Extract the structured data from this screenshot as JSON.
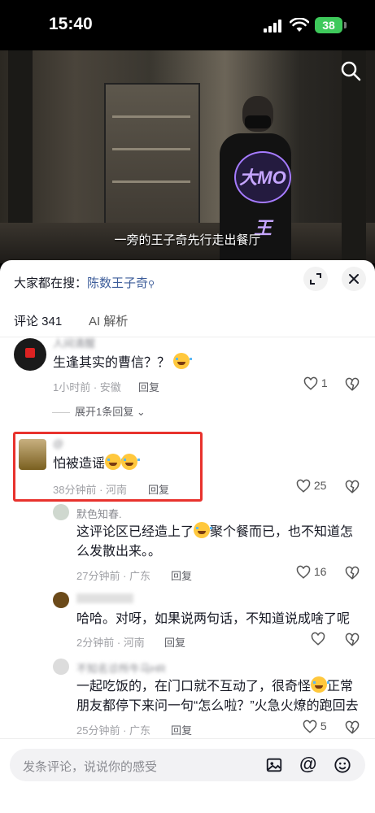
{
  "status_bar": {
    "time": "15:40",
    "battery": "38"
  },
  "video": {
    "subtitle": "一旁的王子奇先行走出餐厅",
    "watermark": "大MO王"
  },
  "panel": {
    "hot_search_label": "大家都在搜：",
    "hot_search_keyword": "陈数王子奇",
    "tabs": [
      {
        "label": "评论 341"
      },
      {
        "label": "AI 解析"
      }
    ]
  },
  "comments": [
    {
      "name": "人间清醒",
      "text": "生逢其实的曹信？？",
      "meta": "1小时前 · 安徽",
      "reply": "回复",
      "likes": "1",
      "expand": "展开1条回复"
    },
    {
      "name": "@",
      "text": "怕被造谣",
      "meta": "38分钟前 · 河南",
      "reply": "回复",
      "likes": "25"
    },
    {
      "name": "默色知春.",
      "text_line1": "这评论区已经造上了",
      "text_line1b": "聚个餐而已，也不知道怎",
      "text_line2": "么发散出来。。",
      "meta": "27分钟前 · 广东",
      "reply": "回复",
      "likes": "16"
    },
    {
      "name": "",
      "text": "哈哈。对呀，如果说两句话，不知道说成啥了呢",
      "meta": "2分钟前 · 河南",
      "reply": "回复",
      "likes": ""
    },
    {
      "name": "不知名诊所牛马HR",
      "text_line1": "一起吃饭的，在门口就不互动了，很奇怪",
      "text_line1b": "正常",
      "text_line2": "朋友都停下来问一句“怎么啦？”火急火燎的跑回去",
      "meta": "25分钟前 · 广东",
      "reply": "回复",
      "likes": "5"
    }
  ],
  "input": {
    "placeholder": "发条评论，说说你的感受"
  },
  "colors": {
    "highlight": "#e8322d",
    "link": "#3d5d9a",
    "battery": "#3ec95b"
  }
}
